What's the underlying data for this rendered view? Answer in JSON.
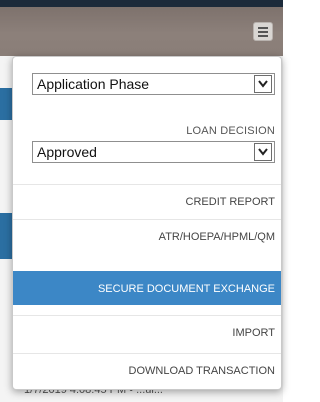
{
  "menu": {
    "phase_select": {
      "value": "Application Phase"
    },
    "decision": {
      "label": "LOAN DECISION",
      "value": "Approved"
    },
    "items": [
      {
        "label": "CREDIT REPORT",
        "active": false
      },
      {
        "label": "ATR/HOEPA/HPML/QM",
        "active": false
      },
      {
        "label": "SECURE DOCUMENT EXCHANGE",
        "active": true
      },
      {
        "label": "IMPORT",
        "active": false
      },
      {
        "label": "DOWNLOAD TRANSACTION",
        "active": false
      }
    ]
  },
  "background": {
    "partial_text": "1/7/2019 4:08:45 PM • ...ul..."
  },
  "colors": {
    "accent": "#3c87c6",
    "header": "#8c807a"
  }
}
